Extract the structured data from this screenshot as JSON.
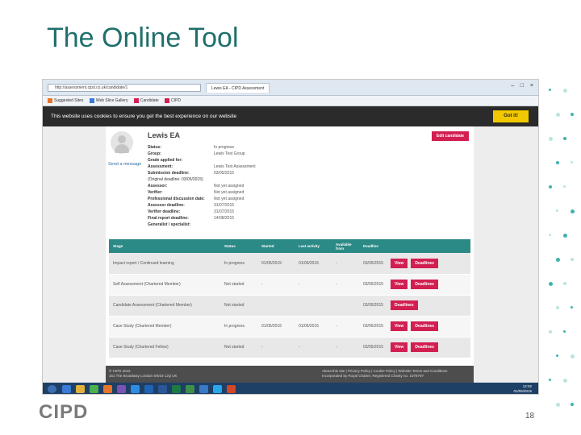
{
  "slide": {
    "title": "The Online Tool",
    "logo": "CIPD",
    "page_number": "18"
  },
  "browser": {
    "address": "http://assessment.cipd.co.uk/candidate/1",
    "tabs": [
      "Lewis EA - CIPD Assessment"
    ],
    "favorites": [
      "Suggested Sites",
      "Web Slice Gallery",
      "Candidate",
      "CIPD"
    ]
  },
  "cookie_banner": {
    "text": "This website uses cookies to ensure you get the best experience on our website",
    "button": "Got it!"
  },
  "candidate": {
    "name": "Lewis EA",
    "send_message": "Send a message",
    "edit_button": "Edit candidate",
    "details": [
      {
        "label": "Status:",
        "value": "In progress"
      },
      {
        "label": "Group:",
        "value": "Lewis Test Group"
      },
      {
        "label": "Grade applied for:",
        "value": ""
      },
      {
        "label": "Assessment:",
        "value": "Lewis Test Assessment"
      },
      {
        "label": "Submission deadline:",
        "value": "03/05/2015"
      },
      {
        "label": "(Original deadline: 03/05/2015)",
        "value": ""
      },
      {
        "label": "Assessor:",
        "value": "Not yet assigned"
      },
      {
        "label": "Verifier:",
        "value": "Not yet assigned"
      },
      {
        "label": "Professional discussion date:",
        "value": "Not yet assigned"
      },
      {
        "label": "Assessor deadline:",
        "value": "31/07/2015"
      },
      {
        "label": "Verifier deadline:",
        "value": "31/07/2015"
      },
      {
        "label": "Final report deadline:",
        "value": "14/08/2015"
      },
      {
        "label": "Generalist / specialist:",
        "value": ""
      }
    ]
  },
  "stage_table": {
    "headers": [
      "Stage",
      "Status",
      "Started",
      "Last activity",
      "Available from",
      "Deadline",
      ""
    ],
    "rows": [
      {
        "stage": "Impact report / Continued learning",
        "status": "In progress",
        "started": "01/05/2015",
        "last": "01/05/2015",
        "available": "-",
        "deadline": "03/05/2015",
        "actions": [
          "View",
          "Deadlines"
        ]
      },
      {
        "stage": "Self Assessment (Chartered Member)",
        "status": "Not started",
        "started": "-",
        "last": "-",
        "available": "-",
        "deadline": "03/05/2015",
        "actions": [
          "View",
          "Deadlines"
        ]
      },
      {
        "stage": "Candidate Assessment (Chartered Member)",
        "status": "Not started",
        "started": "",
        "last": "",
        "available": "",
        "deadline": "03/05/2015",
        "actions": [
          "Deadlines"
        ]
      },
      {
        "stage": "Case Study (Chartered Member)",
        "status": "In progress",
        "started": "01/05/2015",
        "last": "01/05/2015",
        "available": "-",
        "deadline": "03/05/2015",
        "actions": [
          "View",
          "Deadlines"
        ]
      },
      {
        "stage": "Case Study (Chartered Fellow)",
        "status": "Not started",
        "started": "-",
        "last": "-",
        "available": "-",
        "deadline": "03/05/2015",
        "actions": [
          "View",
          "Deadlines"
        ]
      }
    ]
  },
  "footer": {
    "left_line1": "© CIPD 2015",
    "left_line2": "151 The Broadway London SW19 1JQ UK",
    "right_line1": "About this site | Privacy Policy | Cookie Policy | Website Terms and Conditions",
    "right_line2": "Incorporated by Royal Charter, Registered Charity no. 1079797"
  },
  "taskbar": {
    "time": "12:02",
    "date": "01/05/2015",
    "app_icons": [
      "ie-icon",
      "folder-icon",
      "chrome-icon",
      "firefox-icon",
      "media-icon",
      "ie-icon",
      "outlook-icon",
      "word-icon",
      "excel-icon",
      "project-icon",
      "lync-icon",
      "skype-icon",
      "powerpoint-icon"
    ],
    "app_colors": [
      "#3a7bd5",
      "#e1b13c",
      "#4caf50",
      "#e8732a",
      "#7a52b3",
      "#2e8de0",
      "#1f63b5",
      "#2b5797",
      "#1d7a43",
      "#3f8f4a",
      "#3a78c8",
      "#28a8ea",
      "#d24726"
    ]
  },
  "colors": {
    "title": "#1f6f6c",
    "table_header": "#2c8a86",
    "action_button": "#d21f52",
    "cookie_button": "#f2c900"
  }
}
